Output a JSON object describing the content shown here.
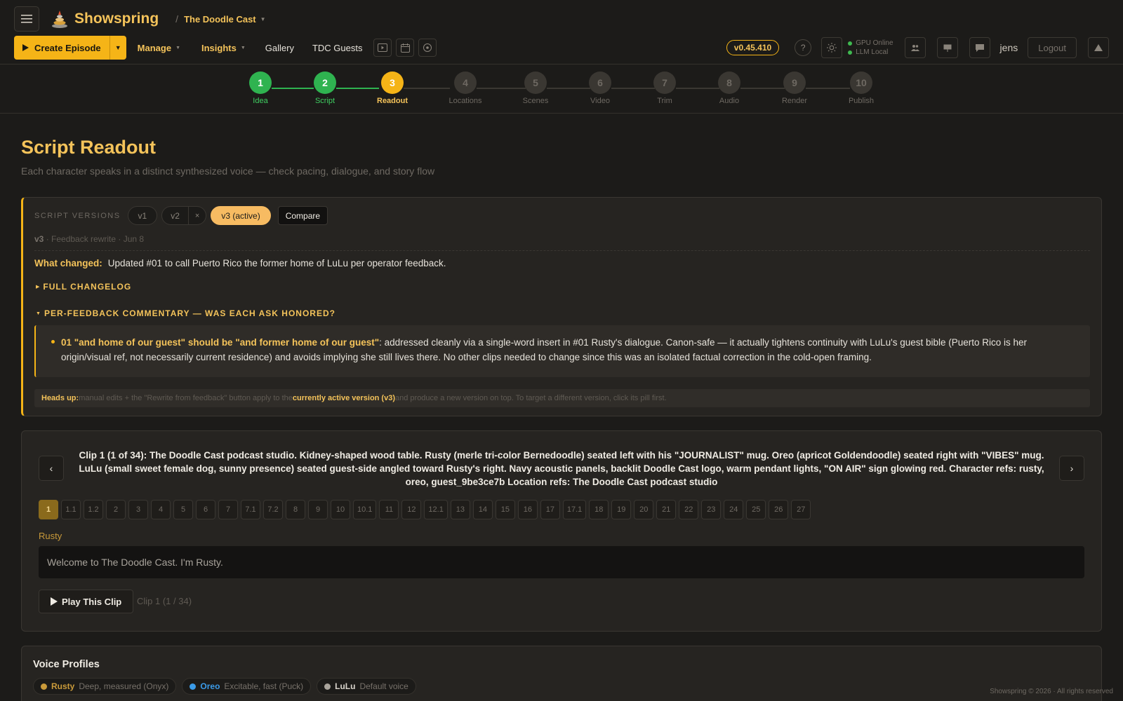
{
  "header": {
    "brand": "Showspring",
    "breadcrumb_sep": "/",
    "breadcrumb": "The Doodle Cast",
    "create_label": "Create Episode",
    "nav": {
      "manage": "Manage",
      "insights": "Insights",
      "gallery": "Gallery",
      "guests": "TDC Guests"
    },
    "version": "v0.45.410",
    "help": "?",
    "status": {
      "gpu": "GPU Online",
      "llm": "LLM Local"
    },
    "user": "jens",
    "logout": "Logout",
    "accent_color": "#f5b417"
  },
  "stepper": {
    "steps": [
      {
        "num": "1",
        "label": "Idea",
        "state": "done"
      },
      {
        "num": "2",
        "label": "Script",
        "state": "done"
      },
      {
        "num": "3",
        "label": "Readout",
        "state": "active"
      },
      {
        "num": "4",
        "label": "Locations",
        "state": "todo"
      },
      {
        "num": "5",
        "label": "Scenes",
        "state": "todo"
      },
      {
        "num": "6",
        "label": "Video",
        "state": "todo"
      },
      {
        "num": "7",
        "label": "Trim",
        "state": "todo"
      },
      {
        "num": "8",
        "label": "Audio",
        "state": "todo"
      },
      {
        "num": "9",
        "label": "Render",
        "state": "todo"
      },
      {
        "num": "10",
        "label": "Publish",
        "state": "todo"
      }
    ]
  },
  "page": {
    "title": "Script Readout",
    "subtitle": "Each character speaks in a distinct synthesized voice — check pacing, dialogue, and story flow"
  },
  "versions": {
    "label": "SCRIPT VERSIONS",
    "v1": "v1",
    "v2": "v2",
    "v2_remove": "×",
    "v3": "v3 (active)",
    "compare": "Compare",
    "meta_version": "v3",
    "meta_rest": " · Feedback rewrite · Jun 8",
    "what_changed_label": "What changed:",
    "what_changed": "Updated #01 to call Puerto Rico the former home of LuLu per operator feedback.",
    "changelog": "FULL CHANGELOG",
    "commentary_head": "PER-FEEDBACK COMMENTARY — WAS EACH ASK HONORED?",
    "commentary_ask": "01 \"and home of our guest\" should be \"and former home of our guest\"",
    "commentary_body": ": addressed cleanly via a single-word insert in #01 Rusty's dialogue. Canon-safe — it actually tightens continuity with LuLu's guest bible (Puerto Rico is her origin/visual ref, not necessarily current residence) and avoids implying she still lives there. No other clips needed to change since this was an isolated factual correction in the cold-open framing.",
    "headsup_label": "Heads up:",
    "headsup_a": " manual edits + the \"Rewrite from feedback\" button apply to the ",
    "headsup_hl": "currently active version (v3)",
    "headsup_b": " and produce a new version on top. To target a different version, click its pill first."
  },
  "clip": {
    "prev": "‹",
    "next": "›",
    "description": "Clip 1 (1 of 34): The Doodle Cast podcast studio. Kidney-shaped wood table. Rusty (merle tri-color Bernedoodle) seated left with his \"JOURNALIST\" mug. Oreo (apricot Goldendoodle) seated right with \"VIBES\" mug. LuLu (small sweet female dog, sunny presence) seated guest-side angled toward Rusty's right. Navy acoustic panels, backlit Doodle Cast logo, warm pendant lights, \"ON AIR\" sign glowing red. Character refs: rusty, oreo, guest_9be3ce7b Location refs: The Doodle Cast podcast studio",
    "chips": [
      "1",
      "1.1",
      "1.2",
      "2",
      "3",
      "4",
      "5",
      "6",
      "7",
      "7.1",
      "7.2",
      "8",
      "9",
      "10",
      "10.1",
      "11",
      "12",
      "12.1",
      "13",
      "14",
      "15",
      "16",
      "17",
      "17.1",
      "18",
      "19",
      "20",
      "21",
      "22",
      "23",
      "24",
      "25",
      "26",
      "27"
    ],
    "active_chip": "1",
    "speaker": "Rusty",
    "dialogue": "Welcome to The Doodle Cast. I'm Rusty.",
    "play": "Play This Clip",
    "counter": "Clip 1 (1 / 34)"
  },
  "voices": {
    "title": "Voice Profiles",
    "items": [
      {
        "name": "Rusty",
        "desc": "Deep, measured (Onyx)",
        "color": "#c99a3a"
      },
      {
        "name": "Oreo",
        "desc": "Excitable, fast (Puck)",
        "color": "#3b9be8"
      },
      {
        "name": "LuLu",
        "desc": "Default voice",
        "color": "#a8a39b"
      }
    ]
  },
  "footer": "Showspring © 2026 · All rights reserved"
}
